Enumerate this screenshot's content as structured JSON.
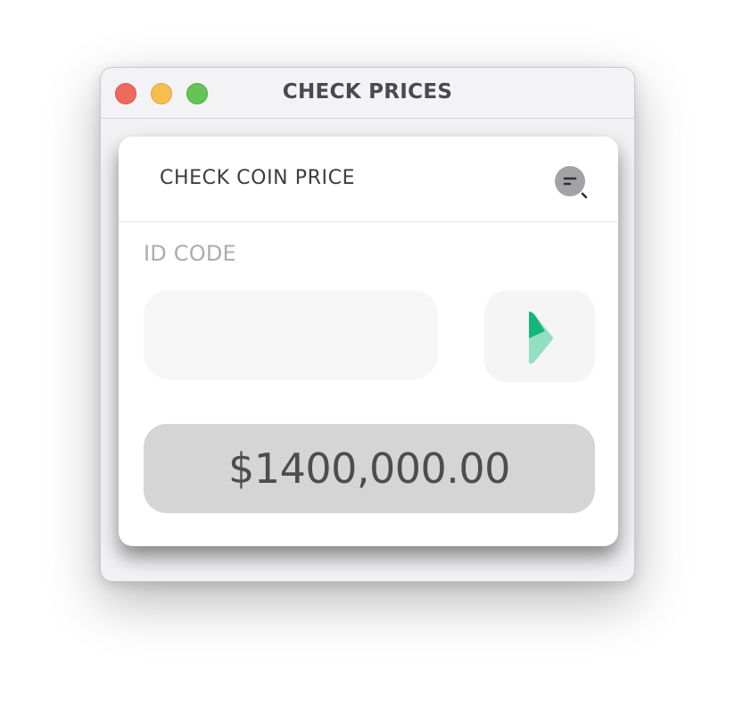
{
  "window": {
    "title": "CHECK PRICES",
    "controls": [
      "close",
      "minimize",
      "maximize"
    ]
  },
  "card": {
    "title": "CHECK COIN PRICE",
    "search_icon": "search-icon",
    "field_label": "ID CODE",
    "id_input": {
      "value": "",
      "placeholder": ""
    },
    "go_icon": "play-arrow-icon",
    "price": "$1400,000.00"
  },
  "colors": {
    "accent_dark": "#13b77b",
    "accent_light": "#93dfc1",
    "price_background": "#d5d5d5",
    "input_background": "#f6f6f6"
  }
}
